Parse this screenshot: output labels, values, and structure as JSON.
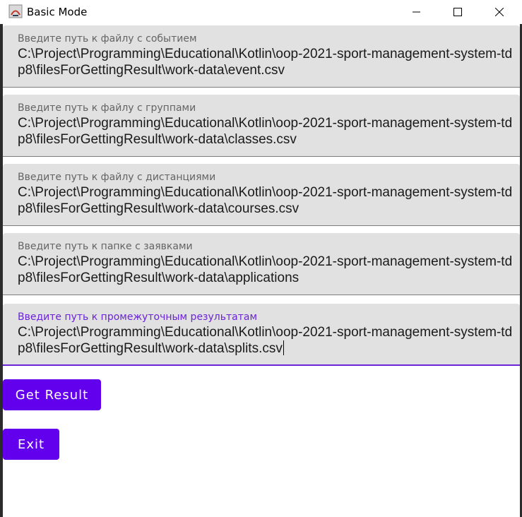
{
  "window": {
    "title": "Basic Mode",
    "icon": "java-icon"
  },
  "fields": [
    {
      "label": "Введите путь к файлу с событием",
      "value": "C:\\Project\\Programming\\Educational\\Kotlin\\oop-2021-sport-management-system-tdp8\\filesForGettingResult\\work-data\\event.csv"
    },
    {
      "label": "Введите путь к файлу с группами",
      "value": "C:\\Project\\Programming\\Educational\\Kotlin\\oop-2021-sport-management-system-tdp8\\filesForGettingResult\\work-data\\classes.csv"
    },
    {
      "label": "Введите путь к файлу с дистанциями",
      "value": "C:\\Project\\Programming\\Educational\\Kotlin\\oop-2021-sport-management-system-tdp8\\filesForGettingResult\\work-data\\courses.csv"
    },
    {
      "label": "Введите путь к папке с заявками",
      "value": "C:\\Project\\Programming\\Educational\\Kotlin\\oop-2021-sport-management-system-tdp8\\filesForGettingResult\\work-data\\applications"
    },
    {
      "label": "Введите путь к промежуточным результатам",
      "value": "C:\\Project\\Programming\\Educational\\Kotlin\\oop-2021-sport-management-system-tdp8\\filesForGettingResult\\work-data\\splits.csv"
    }
  ],
  "buttons": {
    "get_result": "Get Result",
    "exit": "Exit"
  },
  "colors": {
    "accent": "#6200ee",
    "field_bg": "#e1e1e1",
    "active_label": "#6b24d6"
  }
}
